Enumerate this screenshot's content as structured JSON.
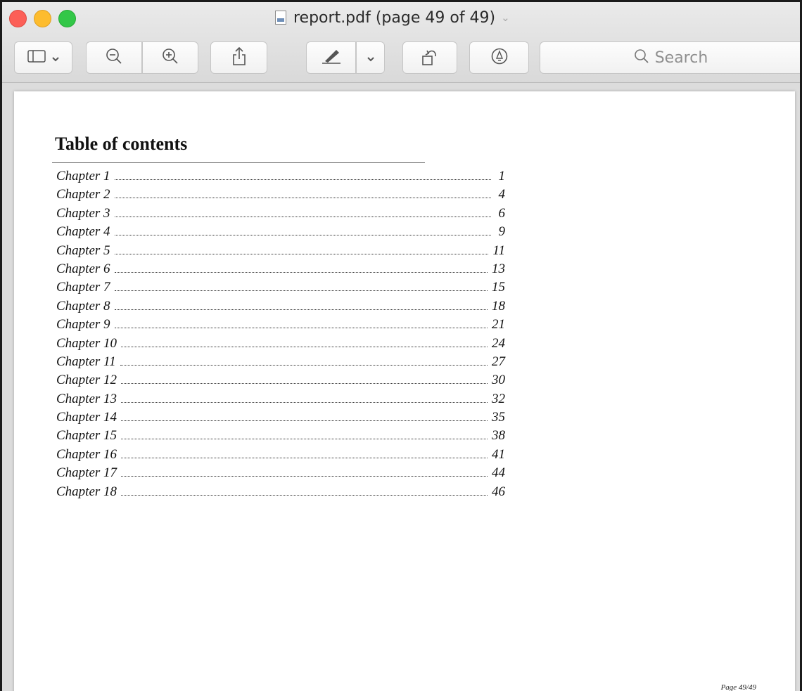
{
  "window": {
    "title": "report.pdf (page 49 of 49)",
    "title_chevron": "⌄"
  },
  "toolbar": {
    "search_placeholder": "Search"
  },
  "document": {
    "heading": "Table of contents",
    "entries": [
      {
        "label": "Chapter 1",
        "page": "1"
      },
      {
        "label": "Chapter 2",
        "page": "4"
      },
      {
        "label": "Chapter 3",
        "page": "6"
      },
      {
        "label": "Chapter 4",
        "page": "9"
      },
      {
        "label": "Chapter 5",
        "page": "11"
      },
      {
        "label": "Chapter 6",
        "page": "13"
      },
      {
        "label": "Chapter 7",
        "page": "15"
      },
      {
        "label": "Chapter 8",
        "page": "18"
      },
      {
        "label": "Chapter 9",
        "page": "21"
      },
      {
        "label": "Chapter 10",
        "page": "24"
      },
      {
        "label": "Chapter 11",
        "page": "27"
      },
      {
        "label": "Chapter 12",
        "page": "30"
      },
      {
        "label": "Chapter 13",
        "page": "32"
      },
      {
        "label": "Chapter 14",
        "page": "35"
      },
      {
        "label": "Chapter 15",
        "page": "38"
      },
      {
        "label": "Chapter 16",
        "page": "41"
      },
      {
        "label": "Chapter 17",
        "page": "44"
      },
      {
        "label": "Chapter 18",
        "page": "46"
      }
    ],
    "footer": "Page 49/49"
  }
}
